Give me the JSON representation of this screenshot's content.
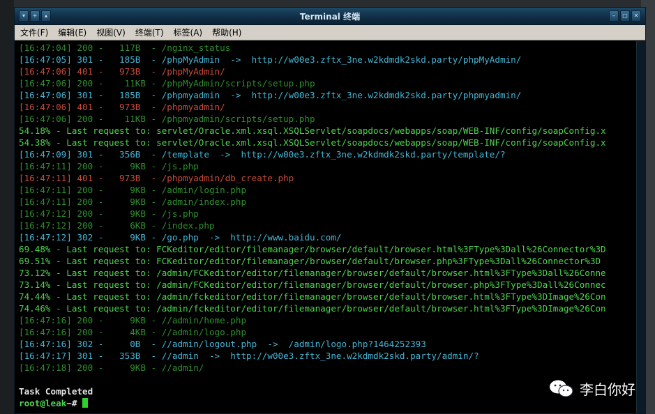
{
  "window": {
    "title": "Terminal 终端"
  },
  "menu": [
    "文件(F)",
    "编辑(E)",
    "视图(V)",
    "终端(T)",
    "标签(A)",
    "帮助(H)"
  ],
  "terminal_lines": [
    {
      "text": "[16:47:04] 200 -   117B  - /nginx_status",
      "style": "dgreen"
    },
    {
      "text": "[16:47:05] 301 -   185B  - /phpMyAdmin  ->  http://w00e3.zftx_3ne.w2kdmdk2skd.party/phpMyAdmin/",
      "style": "cyan"
    },
    {
      "text": "[16:47:06] 401 -   973B  - /phpMyAdmin/",
      "style": "red"
    },
    {
      "text": "[16:47:06] 200 -    11KB - /phpMyAdmin/scripts/setup.php",
      "style": "dgreen"
    },
    {
      "text": "[16:47:06] 301 -   185B  - /phpmyadmin  ->  http://w00e3.zftx_3ne.w2kdmdk2skd.party/phpmyadmin/",
      "style": "cyan"
    },
    {
      "text": "[16:47:06] 401 -   973B  - /phpmyadmin/",
      "style": "red"
    },
    {
      "text": "[16:47:06] 200 -    11KB - /phpmyadmin/scripts/setup.php",
      "style": "dgreen"
    },
    {
      "text": "54.18% - Last request to: servlet/Oracle.xml.xsql.XSQLServlet/soapdocs/webapps/soap/WEB-INF/config/soapConfig.x",
      "style": "green"
    },
    {
      "text": "54.38% - Last request to: servlet/Oracle.xml.xsql.XSQLServlet/soapdocs/webapps/soap/WEB-INF/config/soapConfig.x",
      "style": "green"
    },
    {
      "text": "[16:47:09] 301 -   356B  - /template  ->  http://w00e3.zftx_3ne.w2kdmdk2skd.party/template/?",
      "style": "cyan"
    },
    {
      "text": "[16:47:11] 200 -     9KB - /js.php",
      "style": "dgreen"
    },
    {
      "text": "[16:47:11] 401 -   973B  - /phpmyadmin/db_create.php",
      "style": "red"
    },
    {
      "text": "[16:47:11] 200 -     9KB - /admin/login.php",
      "style": "dgreen"
    },
    {
      "text": "[16:47:11] 200 -     9KB - /admin/index.php",
      "style": "dgreen"
    },
    {
      "text": "[16:47:12] 200 -     9KB - /js.php",
      "style": "dgreen"
    },
    {
      "text": "[16:47:12] 200 -     6KB - /index.php",
      "style": "dgreen"
    },
    {
      "text": "[16:47:12] 302 -     9KB - /go.php  ->  http://www.baidu.com/",
      "style": "cyan"
    },
    {
      "text": "69.48% - Last request to: FCKeditor/editor/filemanager/browser/default/browser.html%3FType%3Dall%26Connector%3D",
      "style": "green"
    },
    {
      "text": "69.51% - Last request to: FCKeditor/editor/filemanager/browser/default/browser.php%3FType%3Dall%26Connector%3D",
      "style": "green"
    },
    {
      "text": "73.12% - Last request to: /admin/FCKeditor/editor/filemanager/browser/default/browser.html%3FType%3Dall%26Conne",
      "style": "green"
    },
    {
      "text": "73.14% - Last request to: /admin/FCKeditor/editor/filemanager/browser/default/browser.php%3FType%3Dall%26Connec",
      "style": "green"
    },
    {
      "text": "74.44% - Last request to: /admin/fckeditor/editor/filemanager/browser/default/browser.html%3FType%3DImage%26Con",
      "style": "green"
    },
    {
      "text": "74.46% - Last request to: /admin/fckeditor/editor/filemanager/browser/default/browser.html%3FType%3DImage%26Con",
      "style": "green"
    },
    {
      "text": "[16:47:16] 200 -     9KB - //admin/home.php",
      "style": "dgreen"
    },
    {
      "text": "[16:47:16] 200 -     4KB - //admin/logo.php",
      "style": "dgreen"
    },
    {
      "text": "[16:47:16] 302 -     0B  - //admin/logout.php  ->  /admin/logo.php?1464252393",
      "style": "cyan"
    },
    {
      "text": "[16:47:17] 301 -   353B  - //admin  ->  http://w00e3.zftx_3ne.w2kdmdk2skd.party/admin/?",
      "style": "cyan"
    },
    {
      "text": "[16:47:18] 200 -     9KB - //admin/",
      "style": "dgreen"
    },
    {
      "text": "",
      "style": "dgreen"
    },
    {
      "text": "Task Completed",
      "style": "white"
    }
  ],
  "prompt": {
    "user": "root@leak",
    "suffix": "~# "
  },
  "watermark": {
    "text": "李白你好",
    "icon": "wechat-icon"
  }
}
